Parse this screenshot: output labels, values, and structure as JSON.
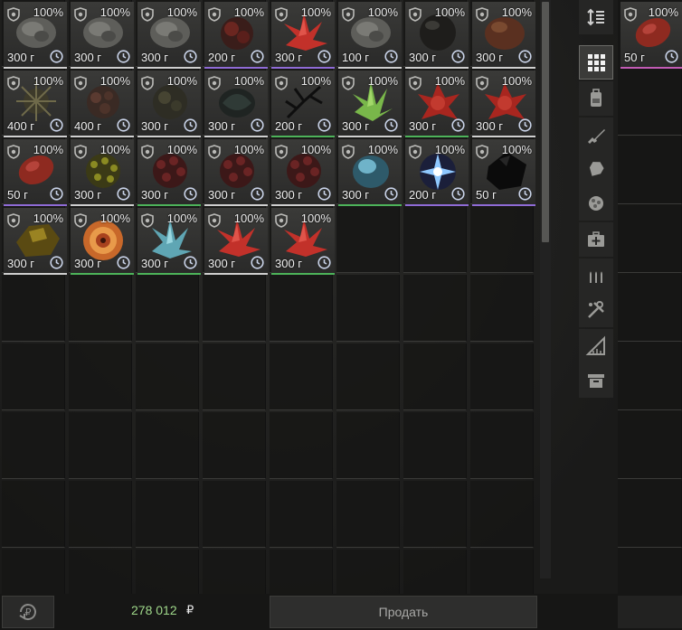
{
  "grid": {
    "items": [
      {
        "pct": "100%",
        "weight": "300 г",
        "art": "gray-rock",
        "rarity": "white"
      },
      {
        "pct": "100%",
        "weight": "300 г",
        "art": "gray-rock",
        "rarity": "white"
      },
      {
        "pct": "100%",
        "weight": "300 г",
        "art": "gray-rock",
        "rarity": "white"
      },
      {
        "pct": "100%",
        "weight": "200 г",
        "art": "dark-red-cluster",
        "rarity": "violet"
      },
      {
        "pct": "100%",
        "weight": "300 г",
        "art": "red-crystal",
        "rarity": "violet"
      },
      {
        "pct": "100%",
        "weight": "100 г",
        "art": "gray-rock",
        "rarity": "white"
      },
      {
        "pct": "100%",
        "weight": "300 г",
        "art": "dark-orb",
        "rarity": "white"
      },
      {
        "pct": "100%",
        "weight": "300 г",
        "art": "brown-lump",
        "rarity": "white"
      },
      {
        "pct": "100%",
        "weight": "400 г",
        "art": "spiky-ball",
        "rarity": "white"
      },
      {
        "pct": "100%",
        "weight": "400 г",
        "art": "brown-cluster",
        "rarity": "white"
      },
      {
        "pct": "100%",
        "weight": "300 г",
        "art": "moss-cluster",
        "rarity": "white"
      },
      {
        "pct": "100%",
        "weight": "300 г",
        "art": "dark-leaf",
        "rarity": "white"
      },
      {
        "pct": "100%",
        "weight": "200 г",
        "art": "black-branch",
        "rarity": "green"
      },
      {
        "pct": "100%",
        "weight": "300 г",
        "art": "green-crystal",
        "rarity": "white"
      },
      {
        "pct": "100%",
        "weight": "300 г",
        "art": "red-spikes",
        "rarity": "green"
      },
      {
        "pct": "100%",
        "weight": "300 г",
        "art": "red-spikes",
        "rarity": "white"
      },
      {
        "pct": "100%",
        "weight": "50 г",
        "art": "red-meat",
        "rarity": "violet"
      },
      {
        "pct": "100%",
        "weight": "300 г",
        "art": "yellow-coral",
        "rarity": "white"
      },
      {
        "pct": "100%",
        "weight": "300 г",
        "art": "red-coral",
        "rarity": "green"
      },
      {
        "pct": "100%",
        "weight": "300 г",
        "art": "red-coral",
        "rarity": "white"
      },
      {
        "pct": "100%",
        "weight": "300 г",
        "art": "red-coral",
        "rarity": "white"
      },
      {
        "pct": "100%",
        "weight": "300 г",
        "art": "blue-shell",
        "rarity": "green"
      },
      {
        "pct": "100%",
        "weight": "200 г",
        "art": "star-burst",
        "rarity": "violet"
      },
      {
        "pct": "100%",
        "weight": "50 г",
        "art": "black-stone",
        "rarity": "violet"
      },
      {
        "pct": "100%",
        "weight": "300 г",
        "art": "gold-rock",
        "rarity": "white"
      },
      {
        "pct": "100%",
        "weight": "300 г",
        "art": "spiral",
        "rarity": "green"
      },
      {
        "pct": "100%",
        "weight": "300 г",
        "art": "cyan-crystal",
        "rarity": "green"
      },
      {
        "pct": "100%",
        "weight": "300 г",
        "art": "red-crystal",
        "rarity": "white"
      },
      {
        "pct": "100%",
        "weight": "300 г",
        "art": "red-crystal",
        "rarity": "green"
      }
    ]
  },
  "stash": {
    "items": [
      {
        "pct": "100%",
        "weight": "50 г",
        "art": "red-meat",
        "rarity": "pink"
      }
    ]
  },
  "categories": [
    {
      "icon": "sort-icon",
      "active": false
    },
    {
      "icon": "grid-icon",
      "active": true
    },
    {
      "icon": "backpack-icon",
      "active": false
    },
    {
      "icon": "rifle-icon",
      "active": false
    },
    {
      "icon": "armor-icon",
      "active": false
    },
    {
      "icon": "artifact-icon",
      "active": false
    },
    {
      "icon": "medkit-icon",
      "active": false
    },
    {
      "icon": "ammo-icon",
      "active": false
    },
    {
      "icon": "tools-icon",
      "active": false
    },
    {
      "icon": "ruler-icon",
      "active": false
    },
    {
      "icon": "box-icon",
      "active": false
    }
  ],
  "footer": {
    "money": "278 012",
    "currency": "₽",
    "sell_label": "Продать"
  },
  "colors": {
    "money": "#9fd88a",
    "rarity_white": "#cfcfcf",
    "rarity_green": "#4db35a",
    "rarity_violet": "#8f6bd6",
    "rarity_pink": "#c25bb5"
  }
}
